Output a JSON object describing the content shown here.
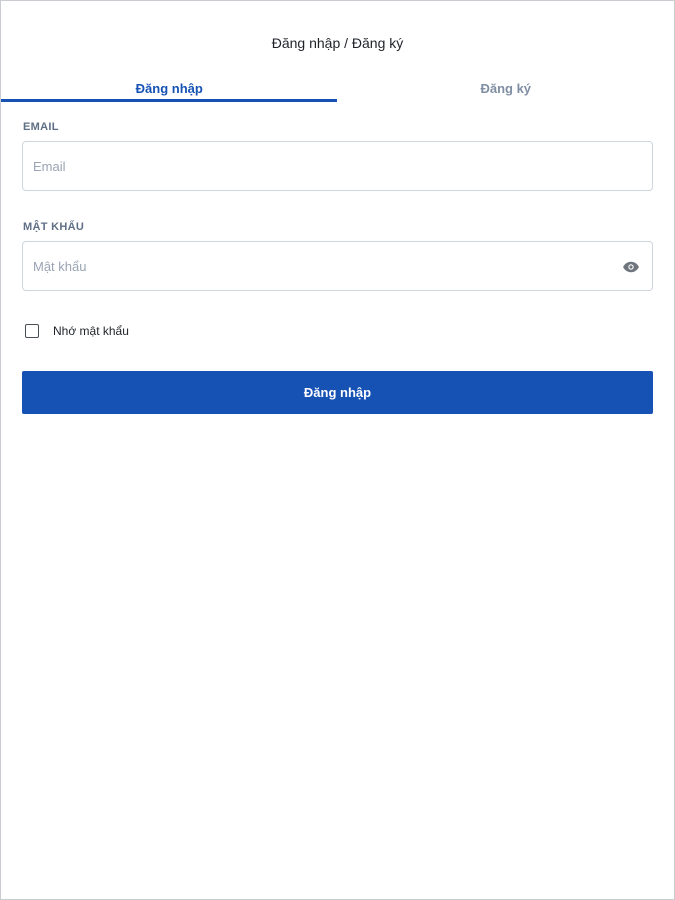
{
  "header": {
    "title": "Đăng nhập / Đăng ký"
  },
  "tabs": [
    {
      "label": "Đăng nhập",
      "active": true
    },
    {
      "label": "Đăng ký",
      "active": false
    }
  ],
  "form": {
    "email": {
      "label": "EMAIL",
      "placeholder": "Email",
      "value": ""
    },
    "password": {
      "label": "MẬT KHẨU",
      "placeholder": "Mật khẩu",
      "value": "",
      "toggle_icon": "eye-icon"
    },
    "remember": {
      "label": "Nhớ mật khẩu",
      "checked": false
    },
    "submit_label": "Đăng nhập"
  },
  "colors": {
    "primary": "#1552b4",
    "inactive_tab": "#7f8ea3",
    "border": "#cfd5dd"
  }
}
